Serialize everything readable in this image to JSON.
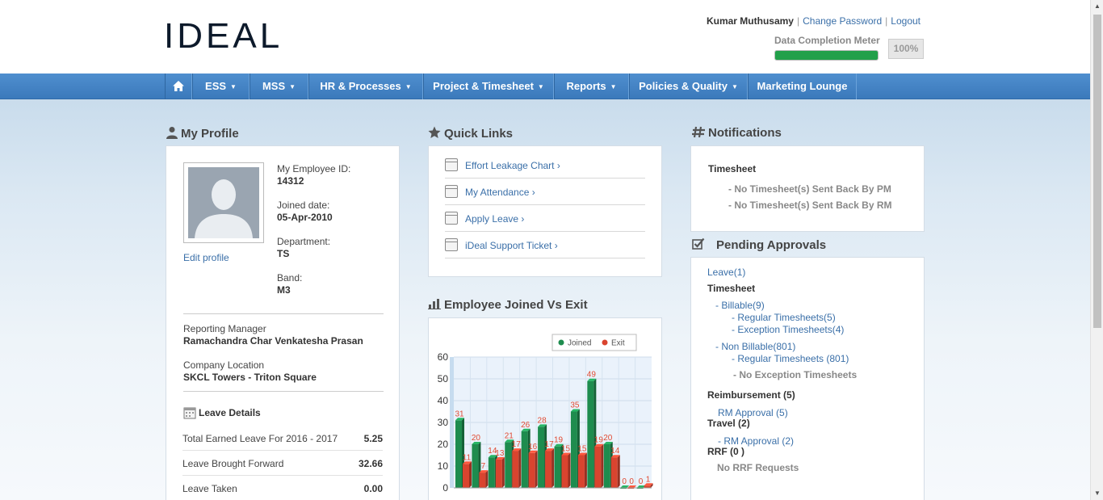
{
  "header": {
    "logo": "IDEAL",
    "user_name": "Kumar Muthusamy",
    "change_password": "Change Password",
    "logout": "Logout",
    "meter_label": "Data Completion Meter",
    "meter_percent": "100%",
    "meter_fraction": 1.0
  },
  "nav": {
    "items": [
      {
        "label": "ESS",
        "caret": true
      },
      {
        "label": "MSS",
        "caret": true
      },
      {
        "label": "HR & Processes",
        "caret": true
      },
      {
        "label": "Project & Timesheet",
        "caret": true
      },
      {
        "label": "Reports",
        "caret": true
      },
      {
        "label": "Policies & Quality",
        "caret": true
      },
      {
        "label": "Marketing Lounge",
        "caret": false
      }
    ]
  },
  "profile": {
    "title": "My Profile",
    "edit_profile": "Edit profile",
    "employee_id_label": "My Employee ID:",
    "employee_id": "14312",
    "joined_label": "Joined date:",
    "joined": "05-Apr-2010",
    "department_label": "Department:",
    "department": "TS",
    "band_label": "Band:",
    "band": "M3",
    "manager_label": "Reporting Manager",
    "manager": "Ramachandra Char Venkatesha Prasan",
    "location_label": "Company Location",
    "location": "SKCL Towers - Triton Square",
    "leave_title": "Leave Details",
    "leave_rows": [
      {
        "label": "Total Earned Leave For 2016 - 2017",
        "value": "5.25"
      },
      {
        "label": "Leave Brought Forward",
        "value": "32.66"
      },
      {
        "label": "Leave Taken",
        "value": "0.00"
      }
    ]
  },
  "quick_links": {
    "title": "Quick Links",
    "items": [
      "Effort Leakage Chart",
      "My Attendance",
      "Apply Leave",
      "iDeal Support Ticket"
    ]
  },
  "chart_section": {
    "title": "Employee Joined Vs Exit"
  },
  "chart_data": {
    "type": "bar",
    "title": "",
    "ylim": [
      0,
      60
    ],
    "yticks": [
      "0",
      "10",
      "20",
      "30",
      "40",
      "50",
      "60"
    ],
    "legend": "top-right",
    "series": [
      {
        "name": "Joined",
        "color": "#1e8c4e",
        "values": [
          31,
          20,
          14,
          21,
          26,
          28,
          19,
          35,
          49,
          20,
          0,
          0
        ]
      },
      {
        "name": "Exit",
        "color": "#d9442f",
        "values": [
          11,
          7,
          13,
          17,
          16,
          17,
          15,
          15,
          19,
          14,
          0,
          1
        ]
      }
    ]
  },
  "notifications": {
    "title": "Notifications",
    "heading": "Timesheet",
    "items": [
      "- No Timesheet(s) Sent Back By PM",
      "- No Timesheet(s) Sent Back By RM"
    ]
  },
  "approvals": {
    "title": "Pending Approvals",
    "leave": "Leave(1)",
    "timesheet": "Timesheet",
    "billable": "- Billable(9)",
    "billable_regular": "- Regular Timesheets(5)",
    "billable_exception": "- Exception Timesheets(4)",
    "nonbillable": "- Non Billable(801)",
    "nonbillable_regular": "- Regular Timesheets (801)",
    "nonbillable_exception": "- No Exception Timesheets",
    "reimbursement": "Reimbursement (5)",
    "rm_approval": "RM Approval (5)",
    "travel": "Travel (2)",
    "travel_rm": "- RM Approval (2)",
    "rrf": "RRF (0 )",
    "rrf_none": "No RRF Requests"
  }
}
